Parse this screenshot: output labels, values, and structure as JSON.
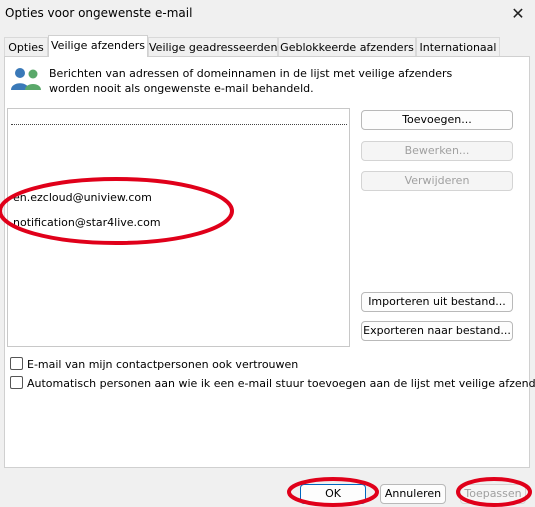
{
  "window": {
    "title": "Opties voor ongewenste e-mail",
    "close_icon": "✕"
  },
  "tabs": [
    {
      "label": "Opties"
    },
    {
      "label": "Veilige afzenders",
      "active": true
    },
    {
      "label": "Veilige geadresseerden"
    },
    {
      "label": "Geblokkeerde afzenders"
    },
    {
      "label": "Internationaal"
    }
  ],
  "description": "Berichten van adressen of domeinnamen in de lijst met veilige afzenders worden nooit als ongewenste e-mail behandeld.",
  "list": {
    "items": [
      "en.ezcloud@uniview.com",
      "notification@star4live.com"
    ]
  },
  "buttons": {
    "add": "Toevoegen...",
    "edit": "Bewerken...",
    "remove": "Verwijderen",
    "import": "Importeren uit bestand...",
    "export": "Exporteren naar bestand..."
  },
  "checkboxes": {
    "trust_contacts": {
      "label": "E-mail van mijn contactpersonen ook vertrouwen",
      "checked": false
    },
    "auto_add": {
      "label": "Automatisch personen aan wie ik een e-mail stuur toevoegen aan de lijst met veilige afzenders",
      "checked": false
    }
  },
  "footer": {
    "ok": "OK",
    "cancel": "Annuleren",
    "apply": "Toepassen"
  },
  "colors": {
    "annotation_red": "#e0001a",
    "primary_border": "#0067c0"
  }
}
